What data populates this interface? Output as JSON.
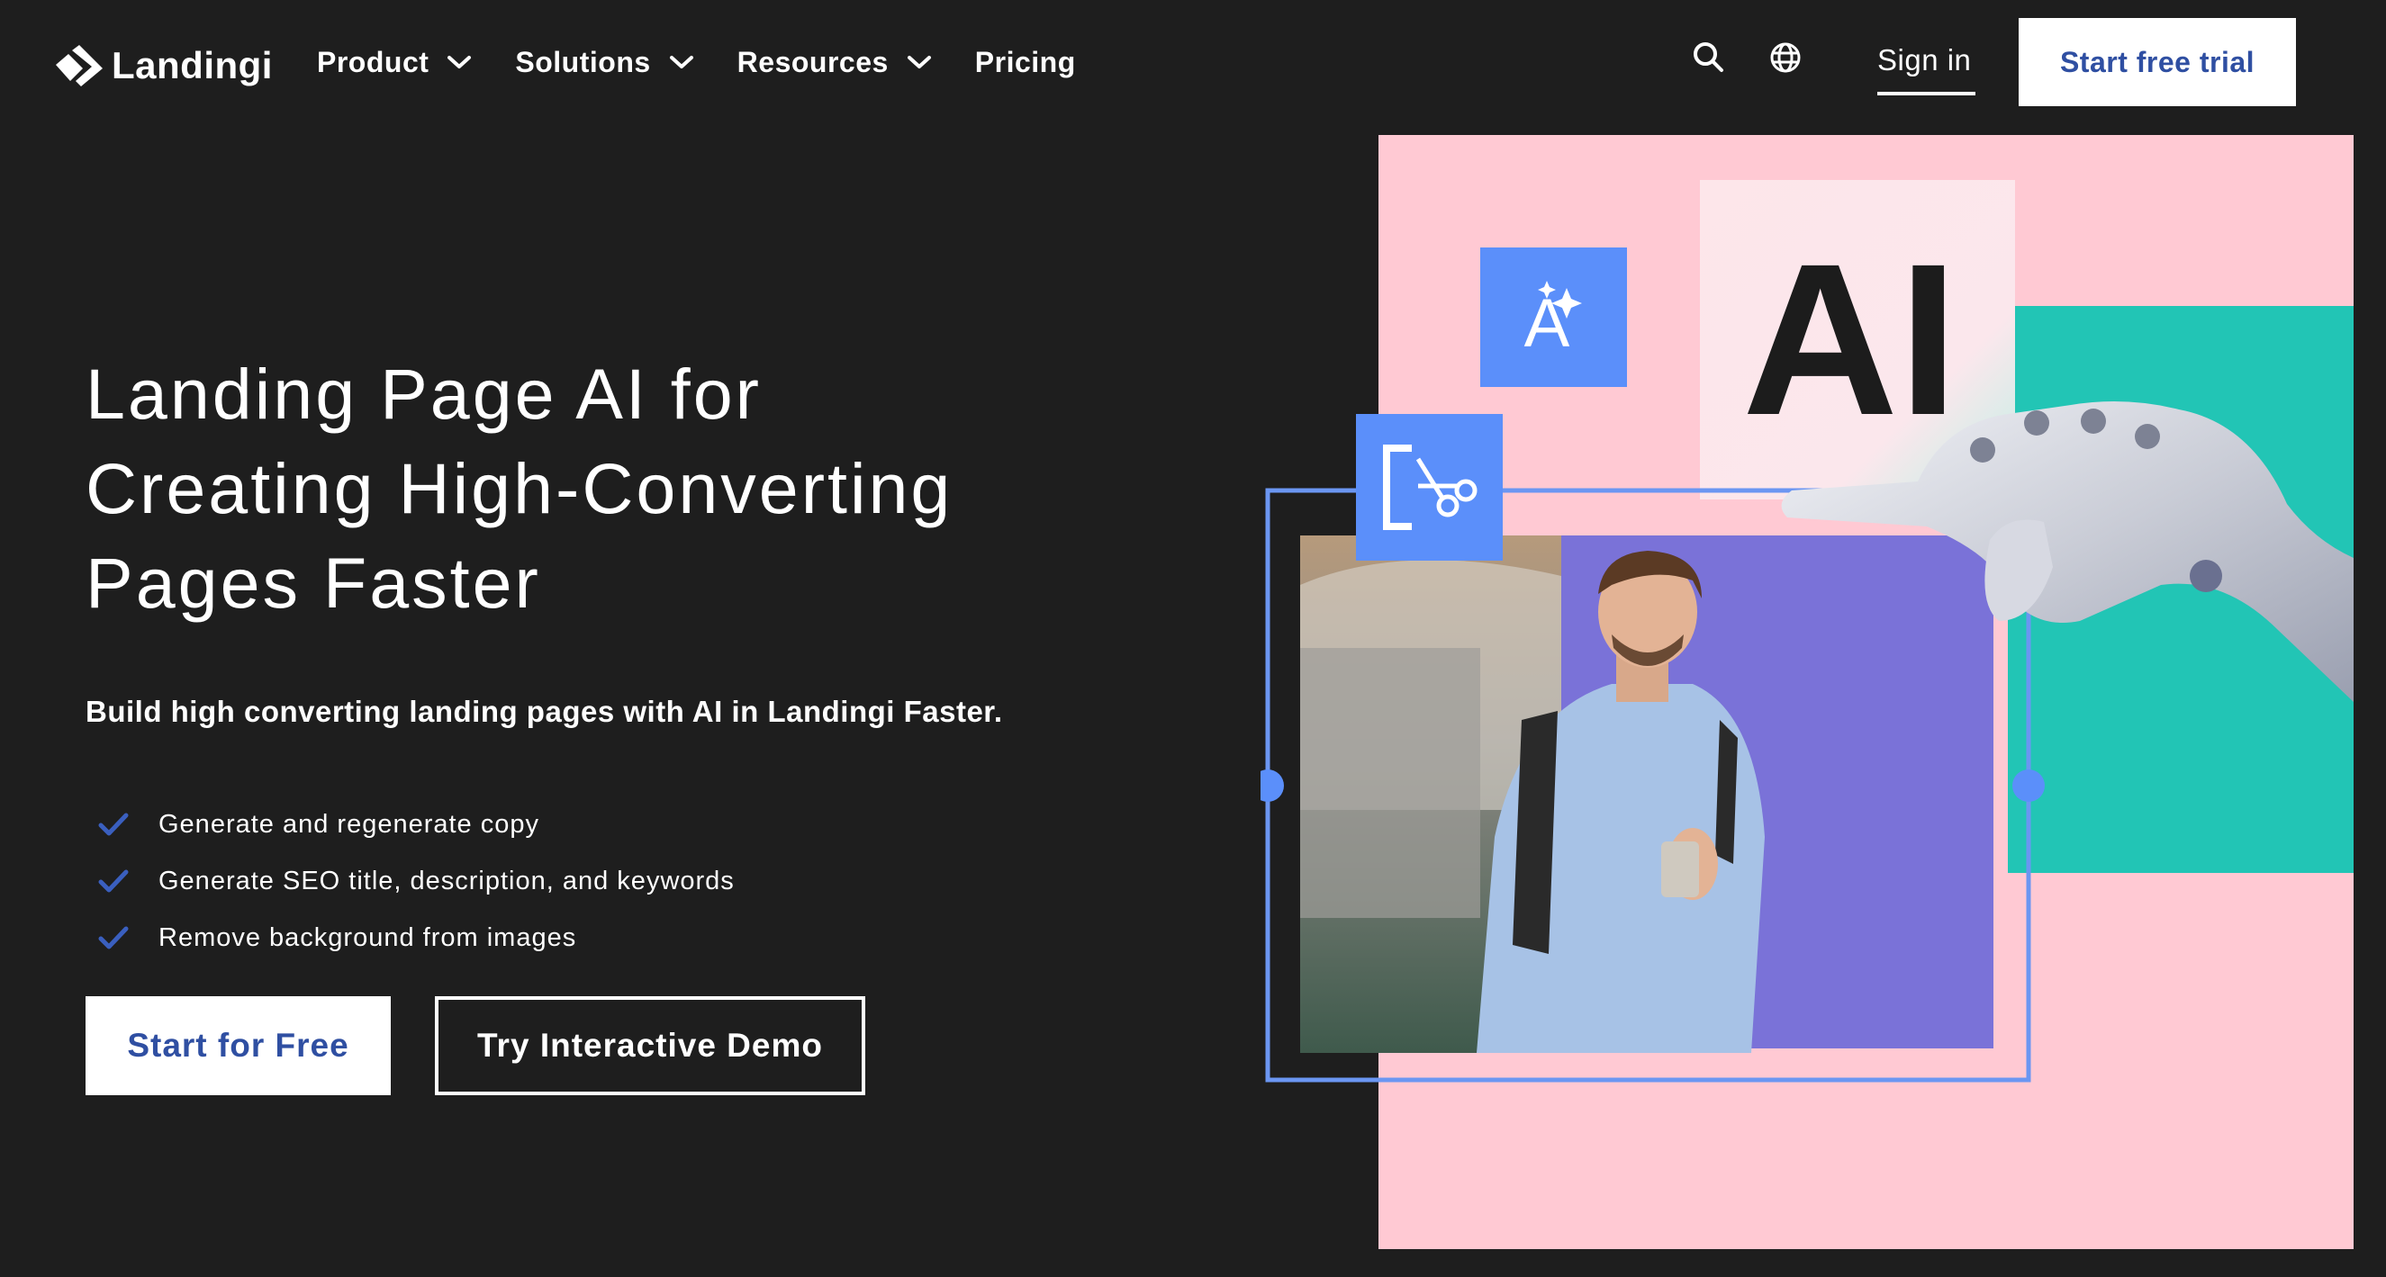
{
  "brand": {
    "name": "Landingi"
  },
  "nav": {
    "items": [
      {
        "label": "Product",
        "has_dropdown": true
      },
      {
        "label": "Solutions",
        "has_dropdown": true
      },
      {
        "label": "Resources",
        "has_dropdown": true
      },
      {
        "label": "Pricing",
        "has_dropdown": false
      }
    ],
    "search_icon": "search-icon",
    "language_icon": "globe-icon",
    "sign_in": "Sign in",
    "trial_button": "Start free trial"
  },
  "hero": {
    "headline_lines": [
      "Landing Page AI for",
      "Creating High-Converting",
      "Pages Faster"
    ],
    "subheadline": "Build high converting landing pages with AI in Landingi Faster.",
    "features": [
      "Generate and regenerate copy",
      "Generate SEO title, description, and keywords",
      "Remove background from images"
    ],
    "primary_cta": "Start for Free",
    "secondary_cta": "Try Interactive Demo"
  },
  "illustration": {
    "ai_label": "AI",
    "icons": [
      "ai-text-icon",
      "crop-cut-icon"
    ]
  },
  "colors": {
    "background": "#1e1e1e",
    "brand_blue": "#2f4fa2",
    "check_blue": "#3a5fbf",
    "pink": "#ffc9d3",
    "teal": "#22c5b5",
    "icon_blue": "#5b8ffa",
    "photo_purple": "#7a72d8",
    "frame_blue": "#6b96f2"
  }
}
